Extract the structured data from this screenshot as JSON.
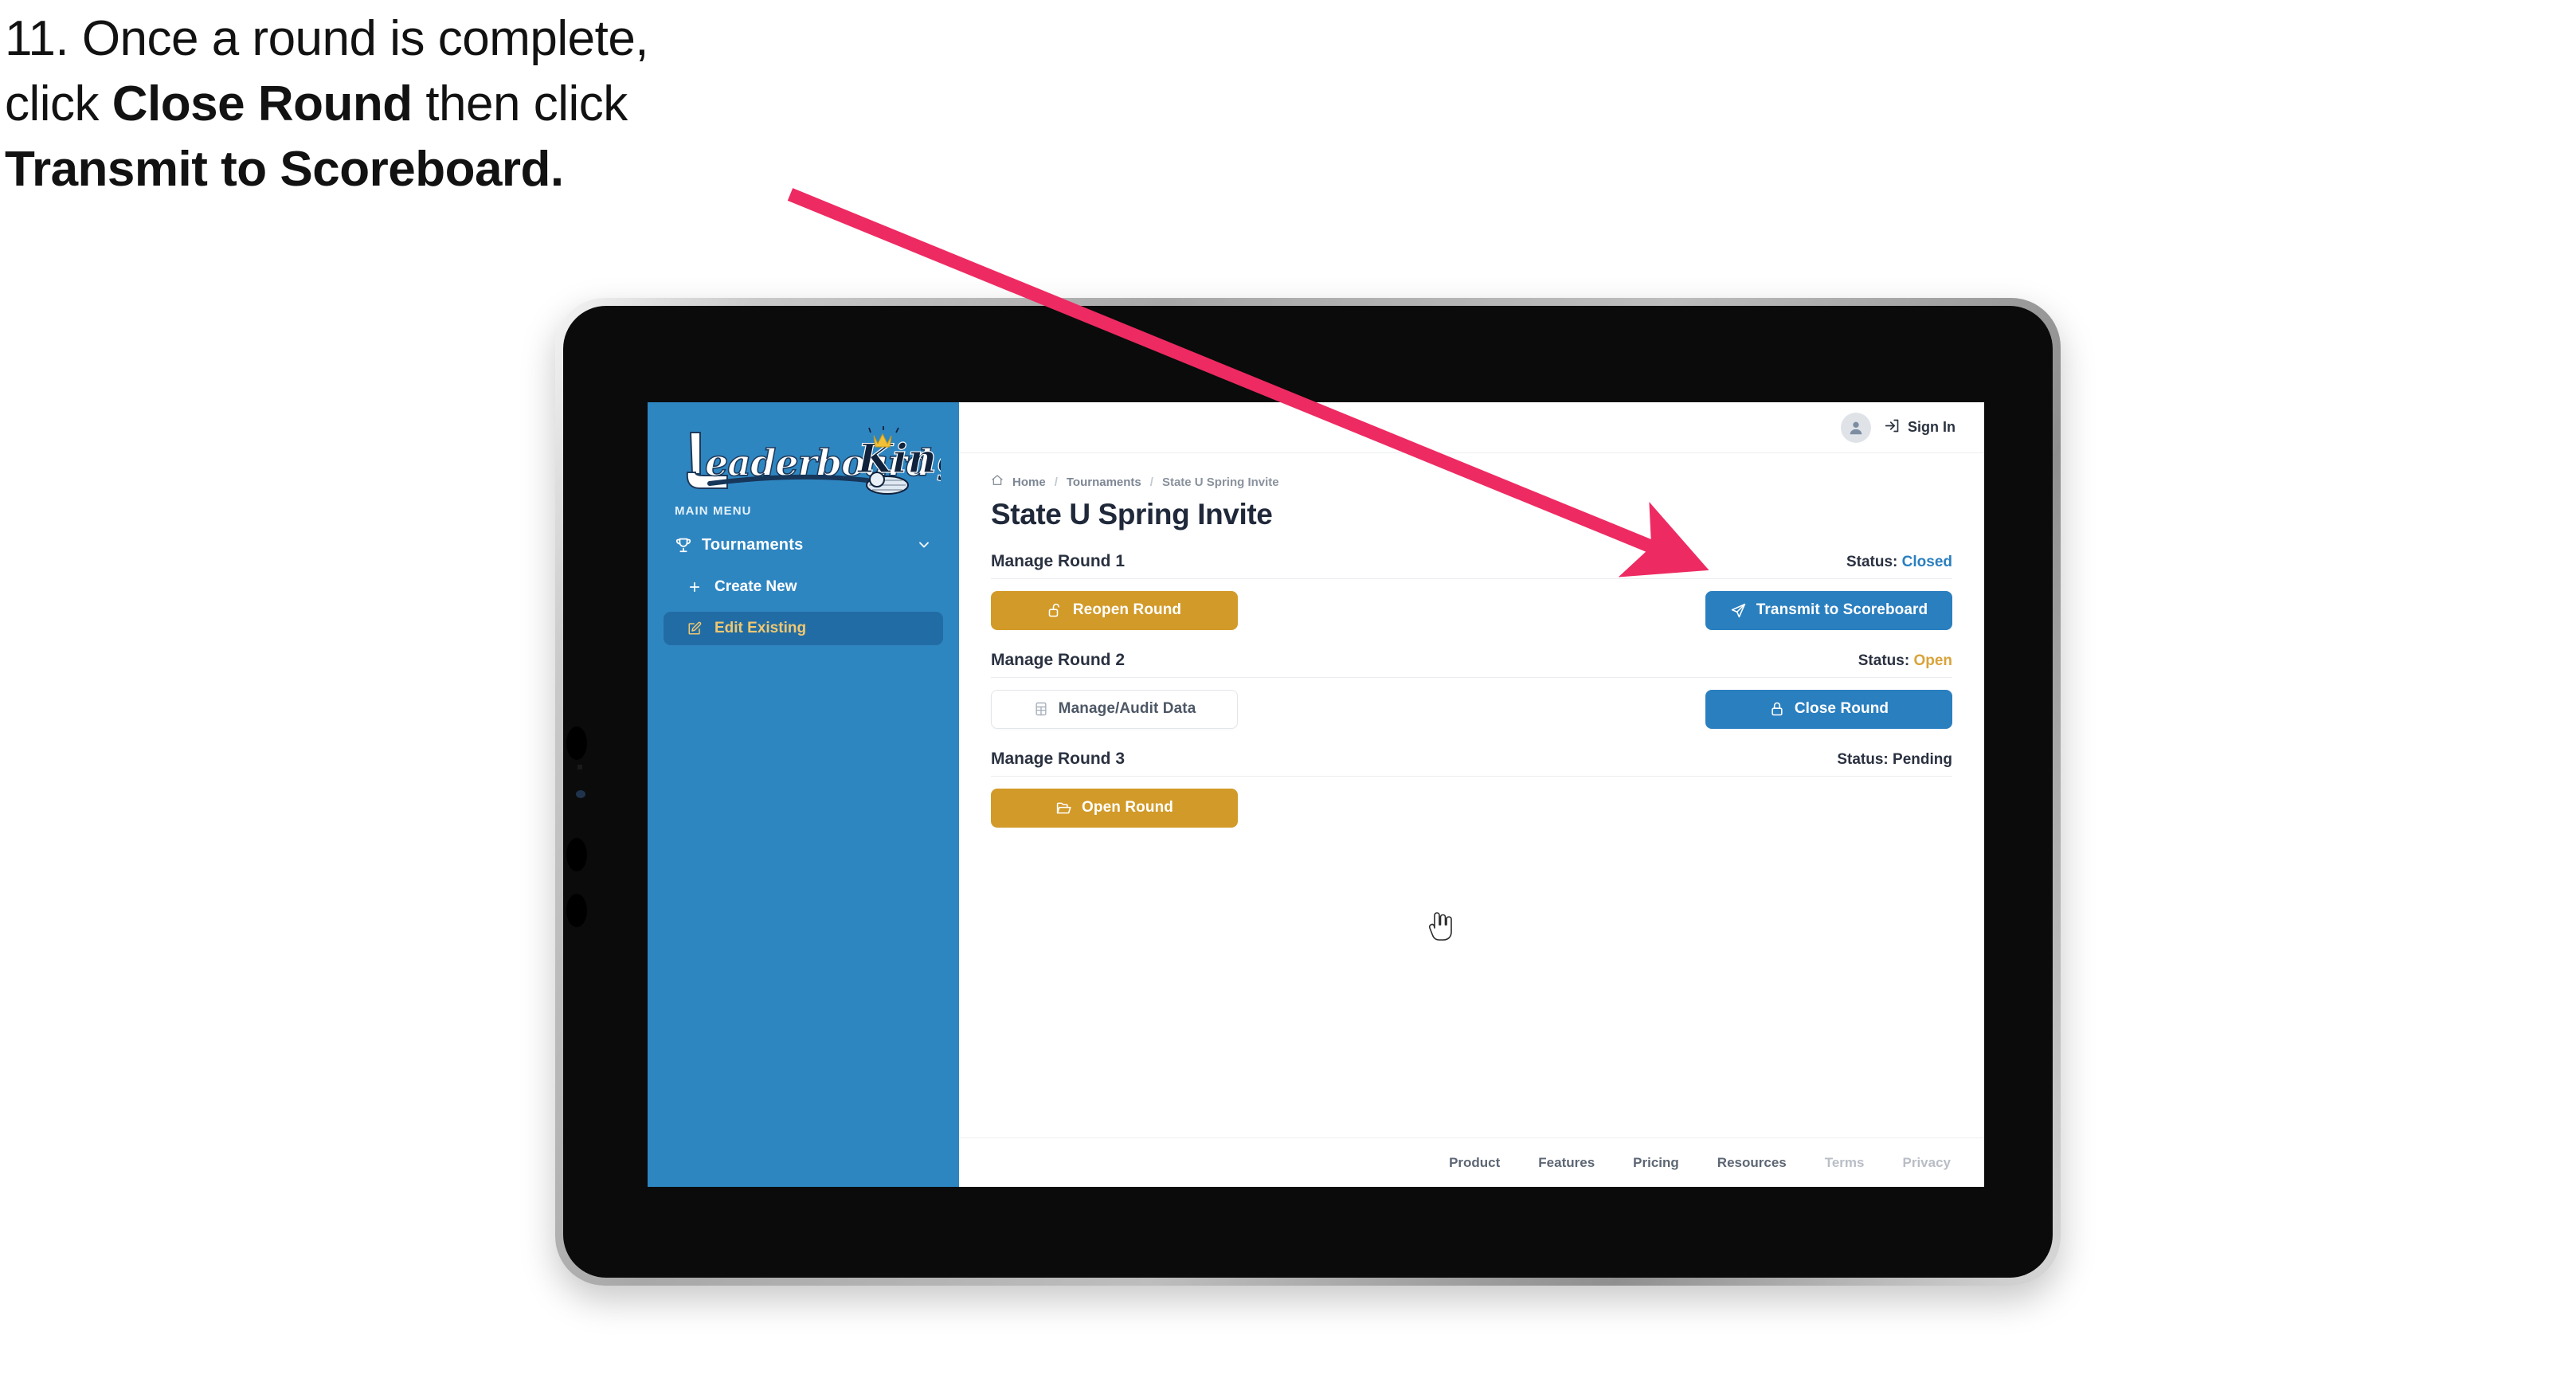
{
  "caption": {
    "line1_prefix": "11. Once a round is complete,",
    "line2_prefix": "click ",
    "line2_bold": "Close Round",
    "line2_suffix": " then click",
    "line3_bold": "Transmit to Scoreboard."
  },
  "annotation": {
    "arrow_color": "#ee2a62"
  },
  "app": {
    "sidebar": {
      "logo_primary": "Leaderboard",
      "logo_secondary": "King",
      "section_label": "MAIN MENU",
      "items": [
        {
          "label": "Tournaments",
          "icon": "trophy-icon",
          "expand_icon": "chevron-down-icon",
          "active": false
        },
        {
          "label": "Create New",
          "icon": "plus-icon",
          "active": false
        },
        {
          "label": "Edit Existing",
          "icon": "pencil-edit-icon",
          "active": true
        }
      ],
      "bg_color": "#2e86c1",
      "active_bg_color": "#226ca5",
      "active_text_color": "#f0c870"
    },
    "topbar": {
      "avatar_icon": "user-avatar-icon",
      "signin_icon": "sign-in-arrow-icon",
      "signin_label": "Sign In"
    },
    "breadcrumb": {
      "home_icon": "home-icon",
      "items": [
        "Home",
        "Tournaments",
        "State U Spring Invite"
      ],
      "separator": "/"
    },
    "page_title": "State U Spring Invite",
    "rounds": [
      {
        "name": "Manage Round 1",
        "status_label": "Status:",
        "status_value": "Closed",
        "status_color": "#2a7fbf",
        "left_button": {
          "label": "Reopen Round",
          "icon": "unlock-icon",
          "style": "amber"
        },
        "right_button": {
          "label": "Transmit to Scoreboard",
          "icon": "send-paper-plane-icon",
          "style": "blue"
        }
      },
      {
        "name": "Manage Round 2",
        "status_label": "Status:",
        "status_value": "Open",
        "status_color": "#d9a33a",
        "left_button": {
          "label": "Manage/Audit Data",
          "icon": "grid-table-icon",
          "style": "ghost"
        },
        "right_button": {
          "label": "Close Round",
          "icon": "lock-icon",
          "style": "blue"
        }
      },
      {
        "name": "Manage Round 3",
        "status_label": "Status:",
        "status_value": "Pending",
        "status_color": "#2a3140",
        "left_button": {
          "label": "Open Round",
          "icon": "open-folder-icon",
          "style": "amber"
        },
        "right_button": null
      }
    ],
    "footer": {
      "links": [
        {
          "label": "Product",
          "muted": false
        },
        {
          "label": "Features",
          "muted": false
        },
        {
          "label": "Pricing",
          "muted": false
        },
        {
          "label": "Resources",
          "muted": false
        },
        {
          "label": "Terms",
          "muted": true
        },
        {
          "label": "Privacy",
          "muted": true
        }
      ]
    }
  }
}
